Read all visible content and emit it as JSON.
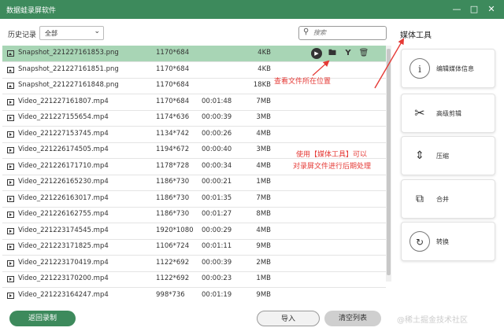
{
  "window": {
    "title": "数据蛙录屏软件",
    "minimize_icon": "minimize-icon",
    "maximize_icon": "maximize-icon",
    "close_icon": "close-icon"
  },
  "toolbar": {
    "history_label": "历史记录",
    "filter_value": "全部",
    "search_placeholder": "搜索"
  },
  "files": [
    {
      "type": "image",
      "name": "Snapshot_221227161853.png",
      "resolution": "1170*684",
      "duration": "",
      "size": "4KB",
      "selected": true
    },
    {
      "type": "image",
      "name": "Snapshot_221227161851.png",
      "resolution": "1170*684",
      "duration": "",
      "size": "4KB"
    },
    {
      "type": "image",
      "name": "Snapshot_221227161848.png",
      "resolution": "1170*684",
      "duration": "",
      "size": "18KB"
    },
    {
      "type": "video",
      "name": "Video_221227161807.mp4",
      "resolution": "1170*684",
      "duration": "00:01:48",
      "size": "7MB"
    },
    {
      "type": "video",
      "name": "Video_221227155654.mp4",
      "resolution": "1174*636",
      "duration": "00:00:39",
      "size": "3MB"
    },
    {
      "type": "video",
      "name": "Video_221227153745.mp4",
      "resolution": "1134*742",
      "duration": "00:00:26",
      "size": "4MB"
    },
    {
      "type": "video",
      "name": "Video_221226174505.mp4",
      "resolution": "1194*672",
      "duration": "00:00:40",
      "size": "3MB"
    },
    {
      "type": "video",
      "name": "Video_221226171710.mp4",
      "resolution": "1178*728",
      "duration": "00:00:34",
      "size": "4MB"
    },
    {
      "type": "video",
      "name": "Video_221226165230.mp4",
      "resolution": "1186*730",
      "duration": "00:00:21",
      "size": "1MB"
    },
    {
      "type": "video",
      "name": "Video_221226163017.mp4",
      "resolution": "1186*730",
      "duration": "00:01:35",
      "size": "7MB"
    },
    {
      "type": "video",
      "name": "Video_221226162755.mp4",
      "resolution": "1186*730",
      "duration": "00:01:27",
      "size": "8MB"
    },
    {
      "type": "video",
      "name": "Video_221223174545.mp4",
      "resolution": "1920*1080",
      "duration": "00:00:29",
      "size": "4MB"
    },
    {
      "type": "video",
      "name": "Video_221223171825.mp4",
      "resolution": "1106*724",
      "duration": "00:01:11",
      "size": "9MB"
    },
    {
      "type": "video",
      "name": "Video_221223170419.mp4",
      "resolution": "1122*692",
      "duration": "00:00:39",
      "size": "2MB"
    },
    {
      "type": "video",
      "name": "Video_221223170200.mp4",
      "resolution": "1122*692",
      "duration": "00:00:23",
      "size": "1MB"
    },
    {
      "type": "video",
      "name": "Video_221223164247.mp4",
      "resolution": "998*736",
      "duration": "00:01:19",
      "size": "9MB"
    }
  ],
  "row_actions": {
    "play_icon": "play-icon",
    "folder_icon": "folder-icon",
    "edit_icon": "edit-tool-icon",
    "delete_icon": "trash-icon"
  },
  "media_tools": {
    "title": "媒体工具",
    "items": [
      {
        "label": "编辑媒体信息",
        "icon": "info-icon"
      },
      {
        "label": "高级剪辑",
        "icon": "scissors-icon"
      },
      {
        "label": "压缩",
        "icon": "compress-icon"
      },
      {
        "label": "合并",
        "icon": "merge-icon"
      },
      {
        "label": "转换",
        "icon": "convert-icon"
      }
    ]
  },
  "annotations": {
    "folder_hint": "查看文件所在位置",
    "tool_hint_line1": "使用【媒体工具】可以",
    "tool_hint_line2": "对录屏文件进行后期处理",
    "color": "#e53935"
  },
  "footer": {
    "back_label": "返回录制",
    "import_label": "导入",
    "clear_label": "清空列表"
  },
  "watermark": "@稀土掘金技术社区",
  "colors": {
    "accent": "#3d8a5c",
    "selected_row": "#a8d5b5"
  }
}
